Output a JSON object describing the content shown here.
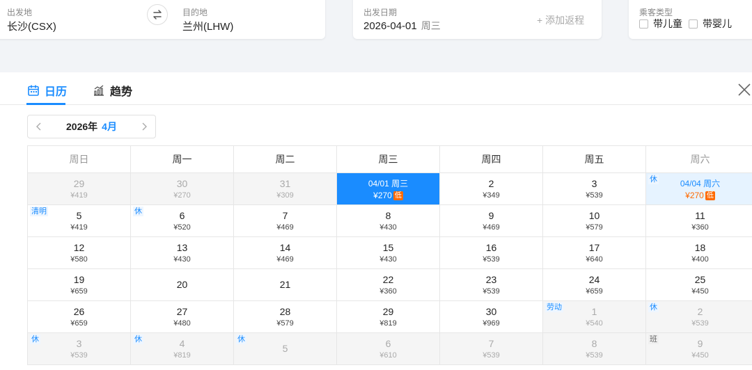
{
  "search": {
    "from_label": "出发地",
    "from_value": "长沙(CSX)",
    "to_label": "目的地",
    "to_value": "兰州(LHW)",
    "date_label": "出发日期",
    "date_value": "2026-04-01",
    "date_weekday": "周三",
    "add_return": "+ 添加返程",
    "passenger_label": "乘客类型",
    "child_label": "带儿童",
    "infant_label": "带婴儿"
  },
  "tabs": {
    "calendar": "日历",
    "trend": "趋势"
  },
  "month_nav": {
    "year": "2026年",
    "month": "4月"
  },
  "colors": {
    "accent": "#1a8cff",
    "low_badge": "#ff6a00"
  },
  "calendar": {
    "weekdays": [
      "周日",
      "周一",
      "周二",
      "周三",
      "周四",
      "周五",
      "周六"
    ],
    "low_badge": "低",
    "weeks": [
      [
        {
          "day": "29",
          "price": "¥419",
          "other": true
        },
        {
          "day": "30",
          "price": "¥270",
          "other": true
        },
        {
          "day": "31",
          "price": "¥309",
          "other": true
        },
        {
          "day": "04/01 周三",
          "price": "¥270",
          "selected": true,
          "low": true
        },
        {
          "day": "2",
          "price": "¥349"
        },
        {
          "day": "3",
          "price": "¥539"
        },
        {
          "day": "04/04 周六",
          "price": "¥270",
          "highlight": true,
          "low": true,
          "tag": "休"
        }
      ],
      [
        {
          "day": "5",
          "price": "¥419",
          "tag": "清明"
        },
        {
          "day": "6",
          "price": "¥520",
          "tag": "休"
        },
        {
          "day": "7",
          "price": "¥469"
        },
        {
          "day": "8",
          "price": "¥430"
        },
        {
          "day": "9",
          "price": "¥469"
        },
        {
          "day": "10",
          "price": "¥579"
        },
        {
          "day": "11",
          "price": "¥360"
        }
      ],
      [
        {
          "day": "12",
          "price": "¥580"
        },
        {
          "day": "13",
          "price": "¥430"
        },
        {
          "day": "14",
          "price": "¥469"
        },
        {
          "day": "15",
          "price": "¥430"
        },
        {
          "day": "16",
          "price": "¥539"
        },
        {
          "day": "17",
          "price": "¥640"
        },
        {
          "day": "18",
          "price": "¥400"
        }
      ],
      [
        {
          "day": "19",
          "price": "¥659"
        },
        {
          "day": "20",
          "price": ""
        },
        {
          "day": "21",
          "price": ""
        },
        {
          "day": "22",
          "price": "¥360"
        },
        {
          "day": "23",
          "price": "¥539"
        },
        {
          "day": "24",
          "price": "¥659"
        },
        {
          "day": "25",
          "price": "¥450"
        }
      ],
      [
        {
          "day": "26",
          "price": "¥659"
        },
        {
          "day": "27",
          "price": "¥480"
        },
        {
          "day": "28",
          "price": "¥579"
        },
        {
          "day": "29",
          "price": "¥819"
        },
        {
          "day": "30",
          "price": "¥969"
        },
        {
          "day": "1",
          "price": "¥540",
          "other": true,
          "tag": "劳动"
        },
        {
          "day": "2",
          "price": "¥539",
          "other": true,
          "tag": "休"
        }
      ],
      [
        {
          "day": "3",
          "price": "¥539",
          "other": true,
          "tag": "休"
        },
        {
          "day": "4",
          "price": "¥819",
          "other": true,
          "tag": "休"
        },
        {
          "day": "5",
          "price": "",
          "other": true,
          "tag": "休"
        },
        {
          "day": "6",
          "price": "¥610",
          "other": true
        },
        {
          "day": "7",
          "price": "¥539",
          "other": true
        },
        {
          "day": "8",
          "price": "¥539",
          "other": true
        },
        {
          "day": "9",
          "price": "¥450",
          "other": true,
          "tag": "班"
        }
      ]
    ]
  }
}
